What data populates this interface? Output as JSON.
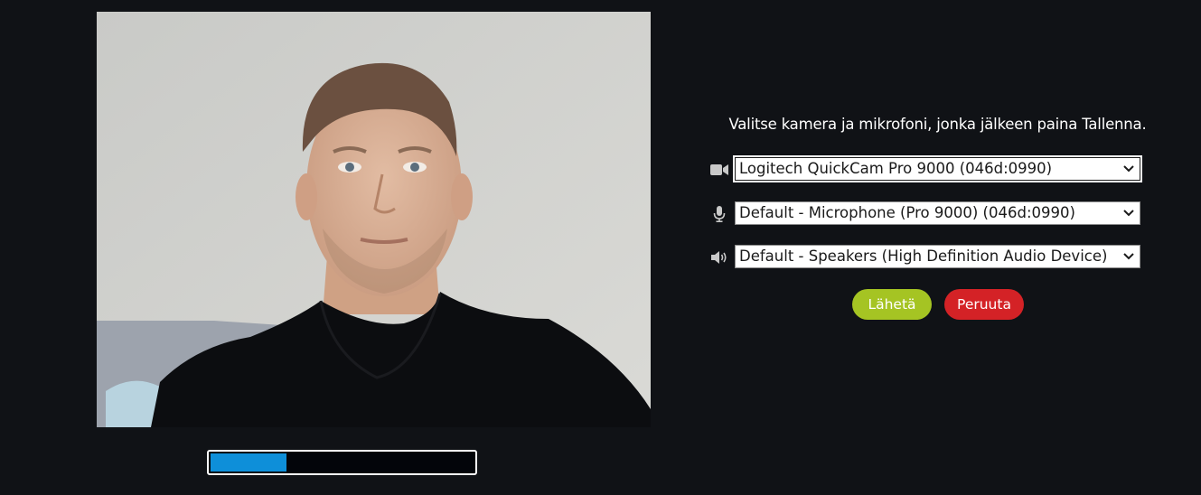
{
  "instruction": "Valitse kamera ja mikrofoni, jonka jälkeen paina Tallenna.",
  "devices": {
    "camera": {
      "icon": "video-camera-icon",
      "selected": "Logitech QuickCam Pro 9000 (046d:0990)"
    },
    "microphone": {
      "icon": "microphone-icon",
      "selected": "Default - Microphone (Pro 9000) (046d:0990)"
    },
    "speaker": {
      "icon": "speaker-icon",
      "selected": "Default - Speakers (High Definition Audio Device)"
    }
  },
  "buttons": {
    "send": "Lähetä",
    "cancel": "Peruuta"
  },
  "mic_level": 0.29,
  "colors": {
    "background": "#101216",
    "send_button": "#a5c423",
    "cancel_button": "#d42226",
    "meter_fill": "#0e8fd9"
  }
}
